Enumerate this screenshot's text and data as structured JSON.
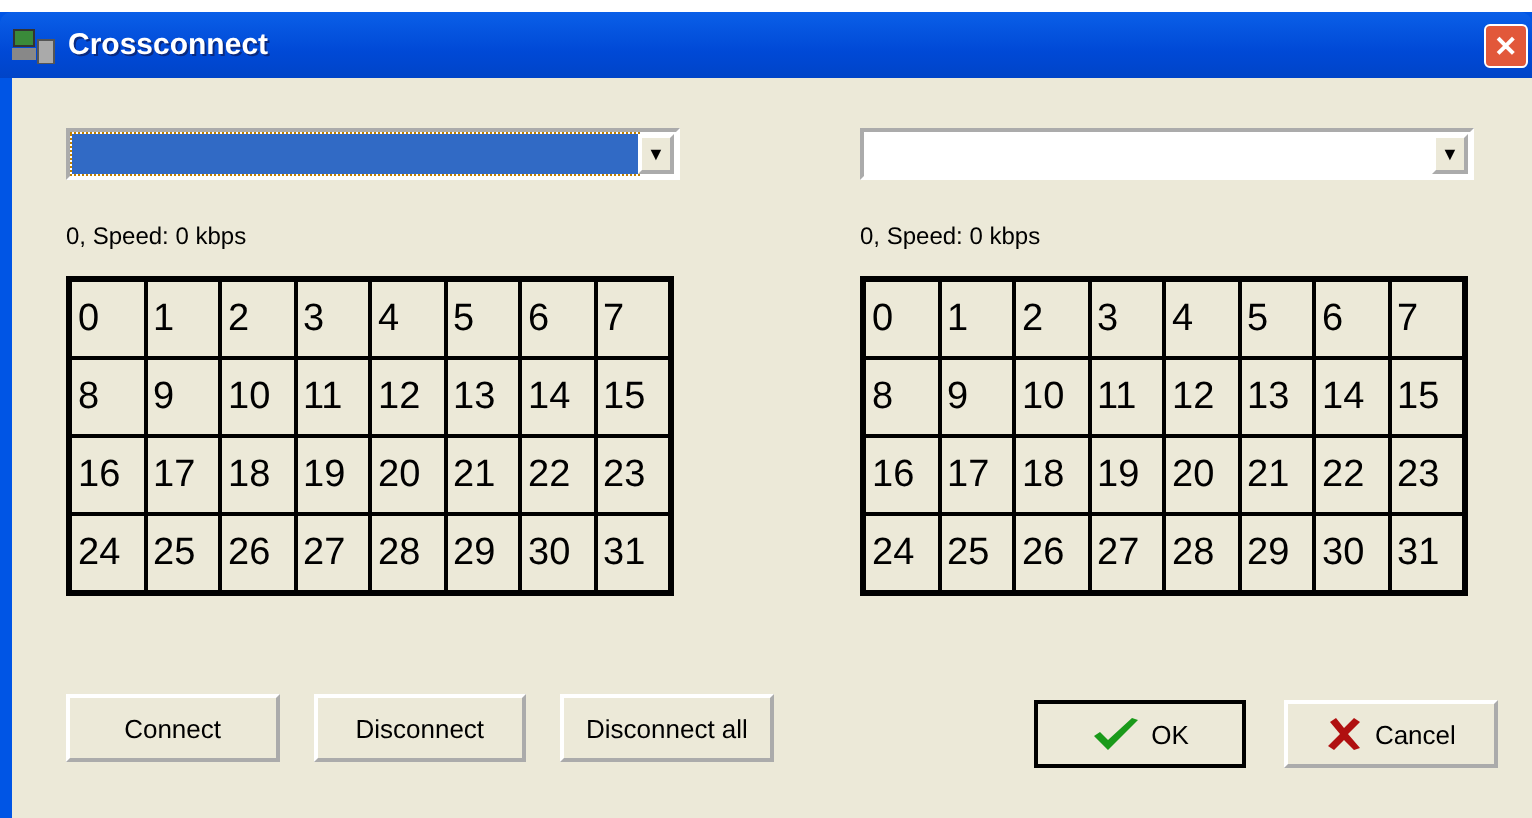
{
  "window": {
    "title": "Crossconnect",
    "close": "✕"
  },
  "panels": [
    {
      "combo": {
        "highlighted": true,
        "arrow": "▼"
      },
      "status": "0, Speed: 0 kbps",
      "channels": [
        "0",
        "1",
        "2",
        "3",
        "4",
        "5",
        "6",
        "7",
        "8",
        "9",
        "10",
        "11",
        "12",
        "13",
        "14",
        "15",
        "16",
        "17",
        "18",
        "19",
        "20",
        "21",
        "22",
        "23",
        "24",
        "25",
        "26",
        "27",
        "28",
        "29",
        "30",
        "31"
      ]
    },
    {
      "combo": {
        "highlighted": false,
        "arrow": "▼"
      },
      "status": "0, Speed: 0 kbps",
      "channels": [
        "0",
        "1",
        "2",
        "3",
        "4",
        "5",
        "6",
        "7",
        "8",
        "9",
        "10",
        "11",
        "12",
        "13",
        "14",
        "15",
        "16",
        "17",
        "18",
        "19",
        "20",
        "21",
        "22",
        "23",
        "24",
        "25",
        "26",
        "27",
        "28",
        "29",
        "30",
        "31"
      ]
    }
  ],
  "buttons": [
    {
      "label": "Connect",
      "kind": "plain"
    },
    {
      "label": "Disconnect",
      "kind": "plain"
    },
    {
      "label": "Disconnect all",
      "kind": "plain"
    },
    {
      "label": "OK",
      "kind": "ok"
    },
    {
      "label": "Cancel",
      "kind": "cancel"
    }
  ]
}
